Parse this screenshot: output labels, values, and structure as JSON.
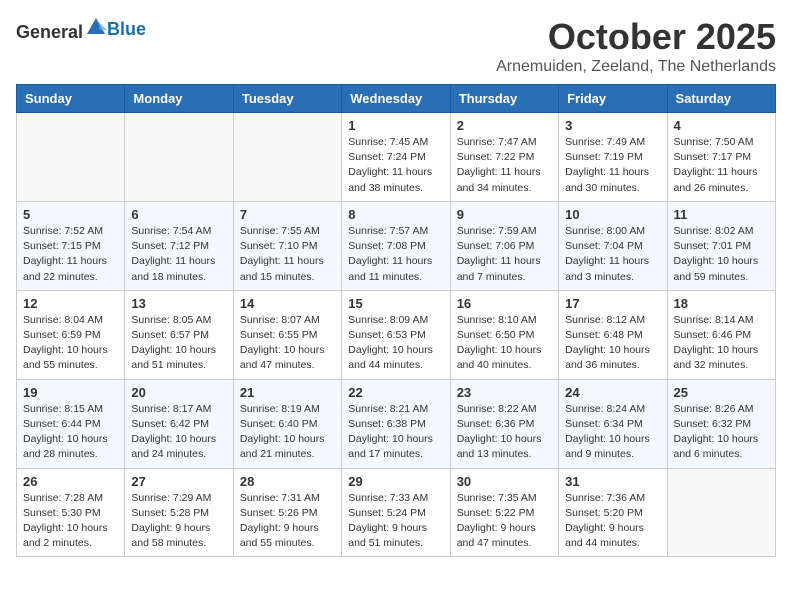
{
  "header": {
    "logo_general": "General",
    "logo_blue": "Blue",
    "month": "October 2025",
    "location": "Arnemuiden, Zeeland, The Netherlands"
  },
  "weekdays": [
    "Sunday",
    "Monday",
    "Tuesday",
    "Wednesday",
    "Thursday",
    "Friday",
    "Saturday"
  ],
  "weeks": [
    [
      {
        "day": "",
        "info": ""
      },
      {
        "day": "",
        "info": ""
      },
      {
        "day": "",
        "info": ""
      },
      {
        "day": "1",
        "info": "Sunrise: 7:45 AM\nSunset: 7:24 PM\nDaylight: 11 hours\nand 38 minutes."
      },
      {
        "day": "2",
        "info": "Sunrise: 7:47 AM\nSunset: 7:22 PM\nDaylight: 11 hours\nand 34 minutes."
      },
      {
        "day": "3",
        "info": "Sunrise: 7:49 AM\nSunset: 7:19 PM\nDaylight: 11 hours\nand 30 minutes."
      },
      {
        "day": "4",
        "info": "Sunrise: 7:50 AM\nSunset: 7:17 PM\nDaylight: 11 hours\nand 26 minutes."
      }
    ],
    [
      {
        "day": "5",
        "info": "Sunrise: 7:52 AM\nSunset: 7:15 PM\nDaylight: 11 hours\nand 22 minutes."
      },
      {
        "day": "6",
        "info": "Sunrise: 7:54 AM\nSunset: 7:12 PM\nDaylight: 11 hours\nand 18 minutes."
      },
      {
        "day": "7",
        "info": "Sunrise: 7:55 AM\nSunset: 7:10 PM\nDaylight: 11 hours\nand 15 minutes."
      },
      {
        "day": "8",
        "info": "Sunrise: 7:57 AM\nSunset: 7:08 PM\nDaylight: 11 hours\nand 11 minutes."
      },
      {
        "day": "9",
        "info": "Sunrise: 7:59 AM\nSunset: 7:06 PM\nDaylight: 11 hours\nand 7 minutes."
      },
      {
        "day": "10",
        "info": "Sunrise: 8:00 AM\nSunset: 7:04 PM\nDaylight: 11 hours\nand 3 minutes."
      },
      {
        "day": "11",
        "info": "Sunrise: 8:02 AM\nSunset: 7:01 PM\nDaylight: 10 hours\nand 59 minutes."
      }
    ],
    [
      {
        "day": "12",
        "info": "Sunrise: 8:04 AM\nSunset: 6:59 PM\nDaylight: 10 hours\nand 55 minutes."
      },
      {
        "day": "13",
        "info": "Sunrise: 8:05 AM\nSunset: 6:57 PM\nDaylight: 10 hours\nand 51 minutes."
      },
      {
        "day": "14",
        "info": "Sunrise: 8:07 AM\nSunset: 6:55 PM\nDaylight: 10 hours\nand 47 minutes."
      },
      {
        "day": "15",
        "info": "Sunrise: 8:09 AM\nSunset: 6:53 PM\nDaylight: 10 hours\nand 44 minutes."
      },
      {
        "day": "16",
        "info": "Sunrise: 8:10 AM\nSunset: 6:50 PM\nDaylight: 10 hours\nand 40 minutes."
      },
      {
        "day": "17",
        "info": "Sunrise: 8:12 AM\nSunset: 6:48 PM\nDaylight: 10 hours\nand 36 minutes."
      },
      {
        "day": "18",
        "info": "Sunrise: 8:14 AM\nSunset: 6:46 PM\nDaylight: 10 hours\nand 32 minutes."
      }
    ],
    [
      {
        "day": "19",
        "info": "Sunrise: 8:15 AM\nSunset: 6:44 PM\nDaylight: 10 hours\nand 28 minutes."
      },
      {
        "day": "20",
        "info": "Sunrise: 8:17 AM\nSunset: 6:42 PM\nDaylight: 10 hours\nand 24 minutes."
      },
      {
        "day": "21",
        "info": "Sunrise: 8:19 AM\nSunset: 6:40 PM\nDaylight: 10 hours\nand 21 minutes."
      },
      {
        "day": "22",
        "info": "Sunrise: 8:21 AM\nSunset: 6:38 PM\nDaylight: 10 hours\nand 17 minutes."
      },
      {
        "day": "23",
        "info": "Sunrise: 8:22 AM\nSunset: 6:36 PM\nDaylight: 10 hours\nand 13 minutes."
      },
      {
        "day": "24",
        "info": "Sunrise: 8:24 AM\nSunset: 6:34 PM\nDaylight: 10 hours\nand 9 minutes."
      },
      {
        "day": "25",
        "info": "Sunrise: 8:26 AM\nSunset: 6:32 PM\nDaylight: 10 hours\nand 6 minutes."
      }
    ],
    [
      {
        "day": "26",
        "info": "Sunrise: 7:28 AM\nSunset: 5:30 PM\nDaylight: 10 hours\nand 2 minutes."
      },
      {
        "day": "27",
        "info": "Sunrise: 7:29 AM\nSunset: 5:28 PM\nDaylight: 9 hours\nand 58 minutes."
      },
      {
        "day": "28",
        "info": "Sunrise: 7:31 AM\nSunset: 5:26 PM\nDaylight: 9 hours\nand 55 minutes."
      },
      {
        "day": "29",
        "info": "Sunrise: 7:33 AM\nSunset: 5:24 PM\nDaylight: 9 hours\nand 51 minutes."
      },
      {
        "day": "30",
        "info": "Sunrise: 7:35 AM\nSunset: 5:22 PM\nDaylight: 9 hours\nand 47 minutes."
      },
      {
        "day": "31",
        "info": "Sunrise: 7:36 AM\nSunset: 5:20 PM\nDaylight: 9 hours\nand 44 minutes."
      },
      {
        "day": "",
        "info": ""
      }
    ]
  ]
}
